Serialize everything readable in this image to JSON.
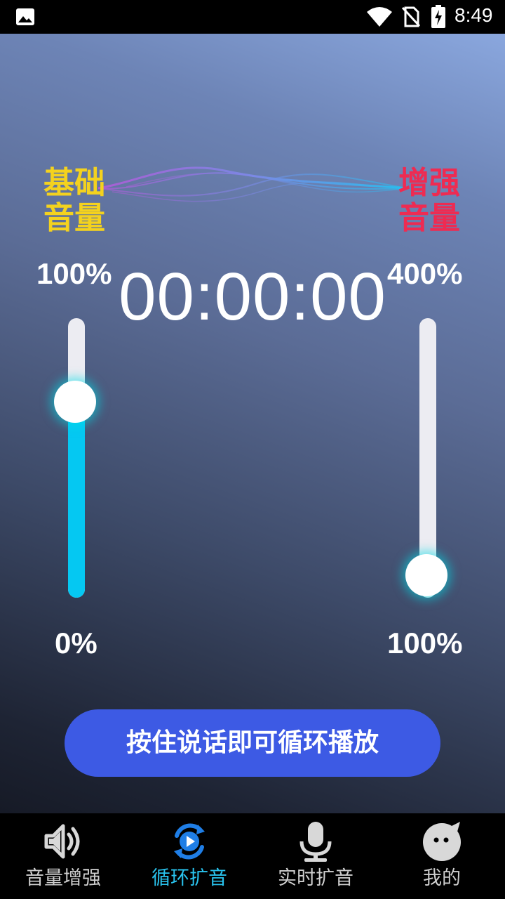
{
  "status_bar": {
    "time": "8:49",
    "icons": [
      "gallery-icon",
      "wifi-icon",
      "no-sim-icon",
      "battery-charging-icon"
    ]
  },
  "labels": {
    "base_volume": [
      "基础",
      "音量"
    ],
    "boost_volume": [
      "增强",
      "音量"
    ]
  },
  "timer": "00:00:00",
  "left_slider": {
    "max_label": "100%",
    "min_label": "0%",
    "value_fraction": 0.7,
    "accent_color": "#05c8f2"
  },
  "right_slider": {
    "max_label": "400%",
    "min_label": "100%",
    "value_fraction": 0.08
  },
  "hold_button": {
    "label": "按住说话即可循环播放",
    "color": "#3d5ae4"
  },
  "bottom_nav": {
    "items": [
      {
        "label": "音量增强",
        "icon": "speaker-volume-icon",
        "active": false
      },
      {
        "label": "循环扩音",
        "icon": "loop-play-icon",
        "active": true
      },
      {
        "label": "实时扩音",
        "icon": "microphone-icon",
        "active": false
      },
      {
        "label": "我的",
        "icon": "profile-face-icon",
        "active": false
      }
    ],
    "active_color": "#29c3ee"
  }
}
